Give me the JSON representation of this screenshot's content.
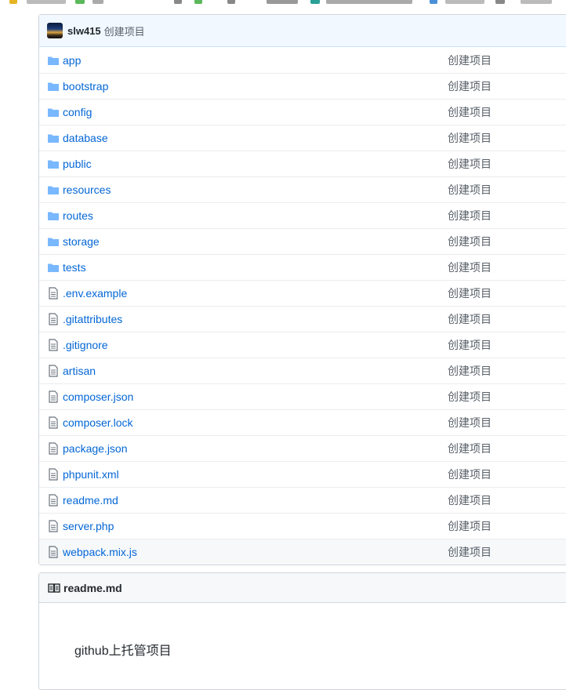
{
  "browser": {
    "bookmark_colors": [
      "#e6b422",
      "#5cb85c",
      "#4a90d9",
      "#888888",
      "#2aa198",
      "#4a90d9",
      "#888888"
    ]
  },
  "commit": {
    "author": "slw415",
    "message": "创建项目"
  },
  "files": [
    {
      "name": "app",
      "type": "dir",
      "message": "创建项目"
    },
    {
      "name": "bootstrap",
      "type": "dir",
      "message": "创建项目"
    },
    {
      "name": "config",
      "type": "dir",
      "message": "创建项目"
    },
    {
      "name": "database",
      "type": "dir",
      "message": "创建项目"
    },
    {
      "name": "public",
      "type": "dir",
      "message": "创建项目"
    },
    {
      "name": "resources",
      "type": "dir",
      "message": "创建项目"
    },
    {
      "name": "routes",
      "type": "dir",
      "message": "创建项目"
    },
    {
      "name": "storage",
      "type": "dir",
      "message": "创建项目"
    },
    {
      "name": "tests",
      "type": "dir",
      "message": "创建项目"
    },
    {
      "name": ".env.example",
      "type": "file",
      "message": "创建项目"
    },
    {
      "name": ".gitattributes",
      "type": "file",
      "message": "创建项目"
    },
    {
      "name": ".gitignore",
      "type": "file",
      "message": "创建项目"
    },
    {
      "name": "artisan",
      "type": "file",
      "message": "创建项目"
    },
    {
      "name": "composer.json",
      "type": "file",
      "message": "创建项目"
    },
    {
      "name": "composer.lock",
      "type": "file",
      "message": "创建项目"
    },
    {
      "name": "package.json",
      "type": "file",
      "message": "创建项目"
    },
    {
      "name": "phpunit.xml",
      "type": "file",
      "message": "创建项目"
    },
    {
      "name": "readme.md",
      "type": "file",
      "message": "创建项目"
    },
    {
      "name": "server.php",
      "type": "file",
      "message": "创建项目"
    },
    {
      "name": "webpack.mix.js",
      "type": "file",
      "message": "创建项目"
    }
  ],
  "readme": {
    "title": "readme.md",
    "content": "github上托管项目"
  },
  "colors": {
    "link": "#0366d6",
    "folder": "#79b8ff",
    "file_icon": "#6a737d",
    "commit_bar_bg": "#f1f8ff"
  },
  "icons": {
    "dir": "folder-icon",
    "file": "file-icon",
    "readme": "book-icon"
  }
}
